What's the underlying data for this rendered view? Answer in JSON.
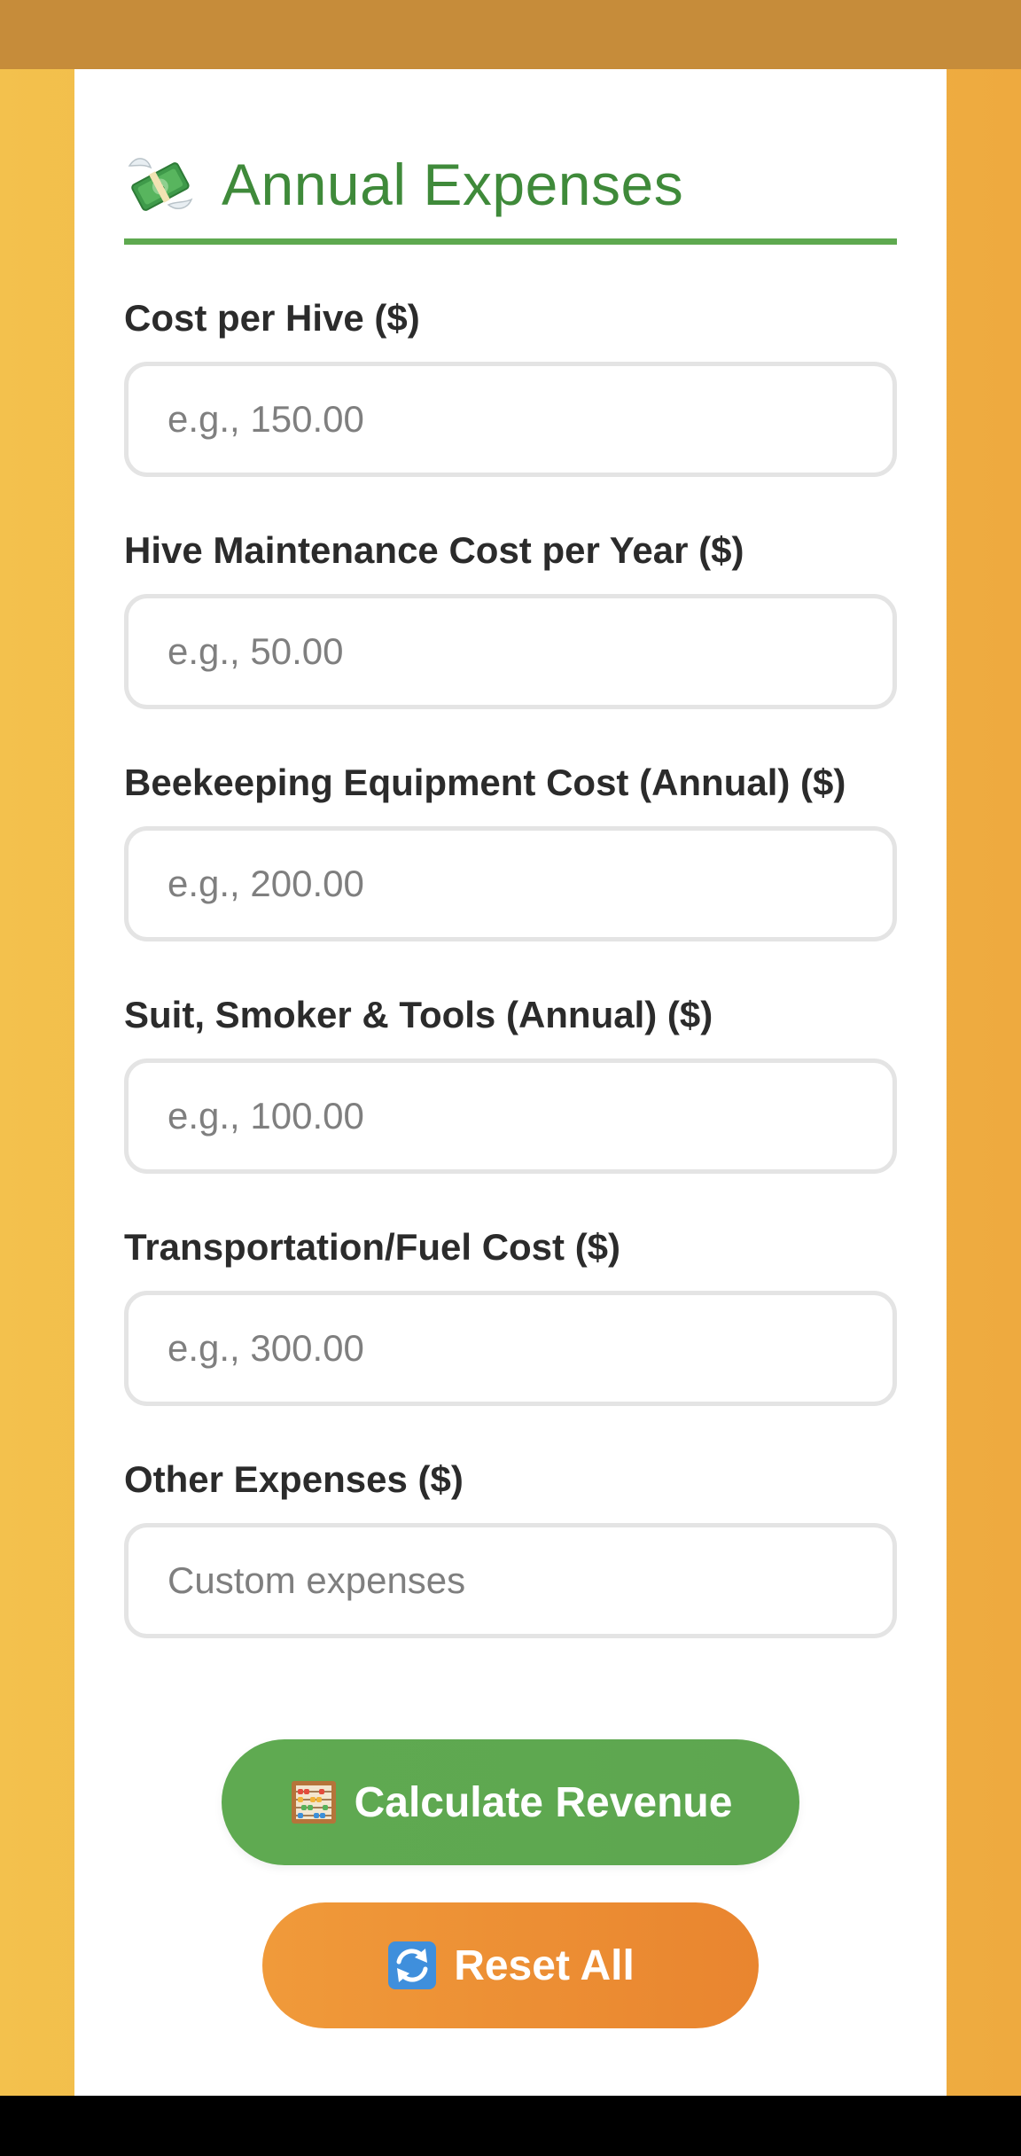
{
  "section": {
    "title": "Annual Expenses",
    "icon": "money-with-wings-icon"
  },
  "fields": [
    {
      "label": "Cost per Hive ($)",
      "placeholder": "e.g., 150.00",
      "value": ""
    },
    {
      "label": "Hive Maintenance Cost per Year ($)",
      "placeholder": "e.g., 50.00",
      "value": ""
    },
    {
      "label": "Beekeeping Equipment Cost (Annual) ($)",
      "placeholder": "e.g., 200.00",
      "value": ""
    },
    {
      "label": "Suit, Smoker & Tools (Annual) ($)",
      "placeholder": "e.g., 100.00",
      "value": ""
    },
    {
      "label": "Transportation/Fuel Cost ($)",
      "placeholder": "e.g., 300.00",
      "value": ""
    },
    {
      "label": "Other Expenses ($)",
      "placeholder": "Custom expenses",
      "value": ""
    }
  ],
  "buttons": {
    "calculate_label": "Calculate Revenue",
    "calculate_icon": "abacus-icon",
    "reset_label": "Reset All",
    "reset_icon": "refresh-arrows-icon"
  },
  "colors": {
    "accent_green": "#5ea94f",
    "title_green": "#3f8a3a",
    "accent_orange": "#ec8f35",
    "background_amber": "#f0b445"
  }
}
